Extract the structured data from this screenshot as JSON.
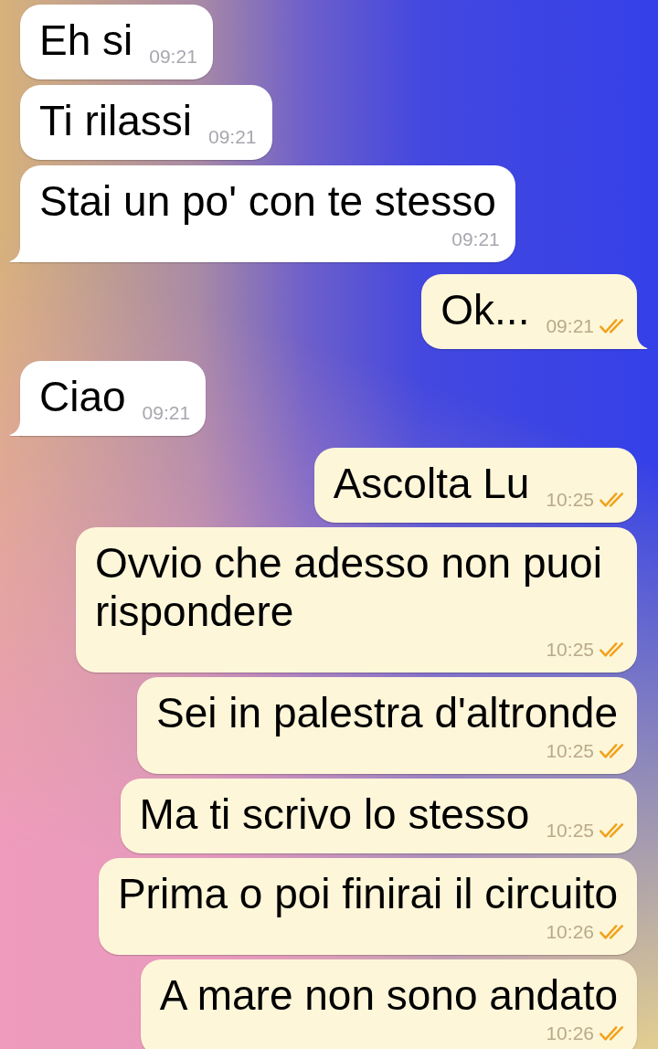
{
  "chat": {
    "groups": [
      {
        "kind": "incoming",
        "messages": [
          {
            "text": "Eh si",
            "time": "09:21",
            "tail": false
          },
          {
            "text": "Ti rilassi",
            "time": "09:21",
            "tail": false
          },
          {
            "text": "Stai un po' con te stesso",
            "time": "09:21",
            "tail": true
          }
        ]
      },
      {
        "kind": "outgoing",
        "messages": [
          {
            "text": "Ok...",
            "time": "09:21",
            "read": true,
            "tail": true
          }
        ]
      },
      {
        "kind": "incoming",
        "messages": [
          {
            "text": "Ciao",
            "time": "09:21",
            "tail": true
          }
        ]
      },
      {
        "kind": "outgoing",
        "messages": [
          {
            "text": "Ascolta Lu",
            "time": "10:25",
            "read": true,
            "tail": false
          },
          {
            "text": "Ovvio che adesso non puoi rispondere",
            "time": "10:25",
            "read": true,
            "tail": false
          },
          {
            "text": "Sei in palestra d'altronde",
            "time": "10:25",
            "read": true,
            "tail": false
          },
          {
            "text": "Ma ti scrivo lo stesso",
            "time": "10:25",
            "read": true,
            "tail": false
          },
          {
            "text": "Prima o poi finirai il circuito",
            "time": "10:26",
            "read": true,
            "tail": false
          },
          {
            "text": "A mare non sono andato",
            "time": "10:26",
            "read": true,
            "tail": false
          }
        ]
      }
    ]
  }
}
